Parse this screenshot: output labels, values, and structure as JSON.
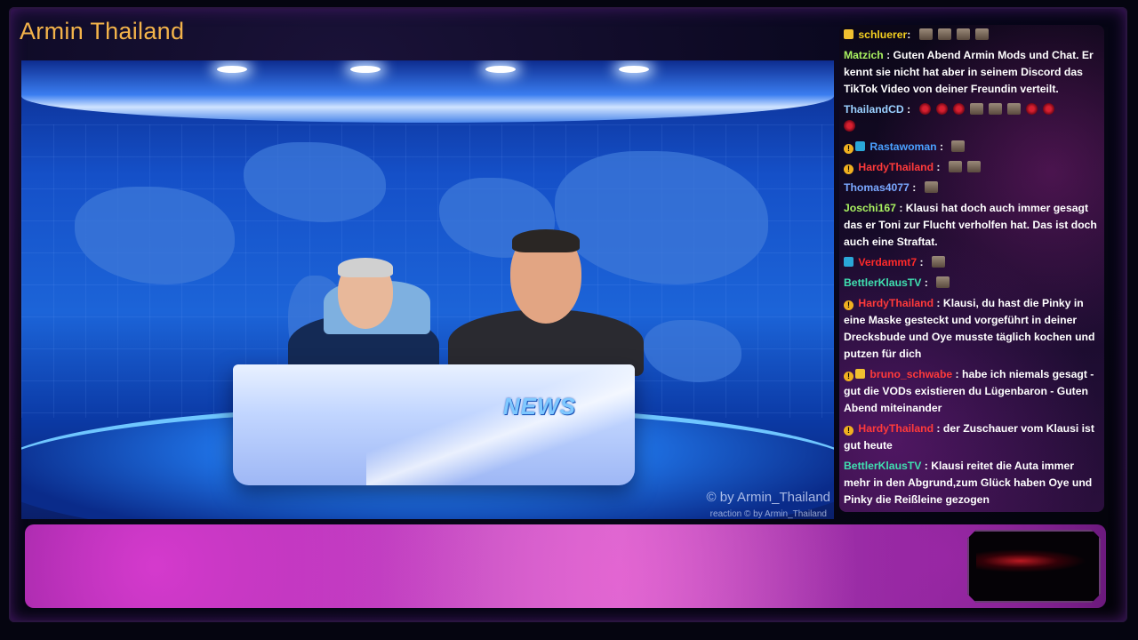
{
  "stream": {
    "channel_title": "Armin Thailand"
  },
  "video": {
    "desk_logo": "NEWS",
    "watermark": "© by Armin_Thailand",
    "watermark_small": "reaction  © by Armin_Thailand"
  },
  "chat": {
    "messages": [
      {
        "user": "schluerer",
        "color": "#f5d020",
        "text": ""
      },
      {
        "user": "Matzich",
        "color": "#a8f060",
        "text": "Guten Abend Armin Mods und Chat. Er kennt sie nicht hat aber in seinem Discord das TikTok Video von deiner Freundin verteilt."
      },
      {
        "user": "ThailandCD",
        "color": "#9ad0ff",
        "text": ""
      },
      {
        "user": "Rastawoman",
        "color": "#4aa0ff",
        "text": ""
      },
      {
        "user": "HardyThailand",
        "color": "#ff3a3a",
        "text": ""
      },
      {
        "user": "Thomas4077",
        "color": "#7aa8ff",
        "text": ""
      },
      {
        "user": "Joschi167",
        "color": "#a8f060",
        "text": "Klausi hat doch auch immer gesagt das er Toni zur Flucht verholfen hat. Das ist doch auch eine Straftat."
      },
      {
        "user": "Verdammt7",
        "color": "#ff2a2a",
        "text": ""
      },
      {
        "user": "BettlerKlausTV",
        "color": "#40e0b0",
        "text": ""
      },
      {
        "user": "HardyThailand",
        "color": "#ff3a3a",
        "text": "Klausi, du hast die Pinky in eine Maske gesteckt und vorgeführt in deiner Drecksbude und Oye musste täglich kochen und putzen für dich"
      },
      {
        "user": "bruno_schwabe",
        "color": "#ff3a3a",
        "text": "habe ich niemals gesagt - gut die VODs existieren du Lügenbaron - Guten Abend miteinander"
      },
      {
        "user": "HardyThailand",
        "color": "#ff3a3a",
        "text": "der Zuschauer vom Klausi ist gut heute"
      },
      {
        "user": "BettlerKlausTV",
        "color": "#40e0b0",
        "text": "Klausi reitet die Auta immer mehr in den Abgrund,zum Glück haben Oye und Pinky die Reißleine gezogen"
      }
    ]
  },
  "colors": {
    "title_orange": "#f3b34a",
    "chat_bg": "#150a28",
    "bottom_bar_magenta": "#c04ac0"
  }
}
